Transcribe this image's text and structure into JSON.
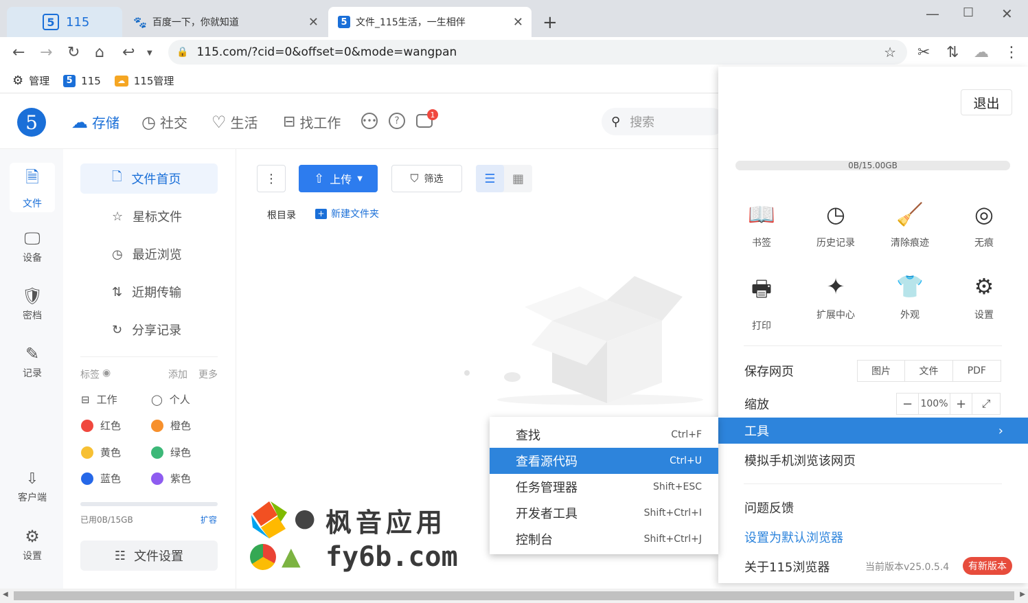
{
  "browser": {
    "tabs": [
      {
        "title": "115"
      },
      {
        "title": "百度一下，你就知道"
      },
      {
        "title": "文件_115生活，一生相伴"
      }
    ],
    "url": "115.com/?cid=0&offset=0&mode=wangpan",
    "bookmarks": [
      {
        "label": "管理"
      },
      {
        "label": "115"
      },
      {
        "label": "115管理"
      }
    ]
  },
  "header": {
    "nav": [
      {
        "label": "存储"
      },
      {
        "label": "社交"
      },
      {
        "label": "生活"
      },
      {
        "label": "找工作"
      }
    ],
    "badge_count": "1",
    "search_placeholder": "搜索"
  },
  "leftbar": {
    "items": [
      {
        "label": "文件"
      },
      {
        "label": "设备"
      },
      {
        "label": "密档"
      },
      {
        "label": "记录"
      },
      {
        "label": "客户端"
      },
      {
        "label": "设置"
      }
    ]
  },
  "nav_panel": {
    "items": [
      {
        "label": "文件首页"
      },
      {
        "label": "星标文件"
      },
      {
        "label": "最近浏览"
      },
      {
        "label": "近期传输"
      },
      {
        "label": "分享记录"
      }
    ],
    "tags_title": "标签",
    "tags_add": "添加",
    "tags_more": "更多",
    "tags": [
      {
        "label": "工作"
      },
      {
        "label": "个人"
      },
      {
        "label": "红色",
        "color": "#f0483e"
      },
      {
        "label": "橙色",
        "color": "#f7902c"
      },
      {
        "label": "黄色",
        "color": "#f7c033"
      },
      {
        "label": "绿色",
        "color": "#3cb878"
      },
      {
        "label": "蓝色",
        "color": "#2668e8"
      },
      {
        "label": "紫色",
        "color": "#8e5cf0"
      }
    ],
    "quota": "已用0B/15GB",
    "expand": "扩容",
    "file_settings": "文件设置"
  },
  "main": {
    "upload": "上传",
    "filter": "筛选",
    "breadcrumb_root": "根目录",
    "new_folder": "新建文件夹"
  },
  "menu": {
    "logout": "退出",
    "quota": "0B/15.00GB",
    "grid": [
      {
        "label": "书签",
        "icon": "book-icon"
      },
      {
        "label": "历史记录",
        "icon": "clock-icon"
      },
      {
        "label": "清除痕迹",
        "icon": "brush-icon"
      },
      {
        "label": "无痕",
        "icon": "mask-icon"
      },
      {
        "label": "打印",
        "icon": "printer-icon"
      },
      {
        "label": "扩展中心",
        "icon": "puzzle-icon"
      },
      {
        "label": "外观",
        "icon": "shirt-icon"
      },
      {
        "label": "设置",
        "icon": "gear-icon"
      }
    ],
    "save_page": "保存网页",
    "save_options": [
      "图片",
      "文件",
      "PDF"
    ],
    "zoom": "缩放",
    "zoom_value": "100%",
    "tools": "工具",
    "mobile_view": "模拟手机浏览该网页",
    "feedback": "问题反馈",
    "set_default": "设置为默认浏览器",
    "about": "关于115浏览器",
    "version": "当前版本v25.0.5.4",
    "new_version": "有新版本"
  },
  "submenu": {
    "items": [
      {
        "label": "查找",
        "key": "Ctrl+F"
      },
      {
        "label": "查看源代码",
        "key": "Ctrl+U"
      },
      {
        "label": "任务管理器",
        "key": "Shift+ESC"
      },
      {
        "label": "开发者工具",
        "key": "Shift+Ctrl+I"
      },
      {
        "label": "控制台",
        "key": "Shift+Ctrl+J"
      }
    ]
  },
  "watermark": {
    "line1": "枫音应用",
    "line2": "fy6b.com"
  },
  "colors": {
    "accent": "#1a6fd8",
    "menu_highlight": "#2d84dc",
    "upload_button": "#2d7cee",
    "new_version_badge": "#e74c3c"
  }
}
